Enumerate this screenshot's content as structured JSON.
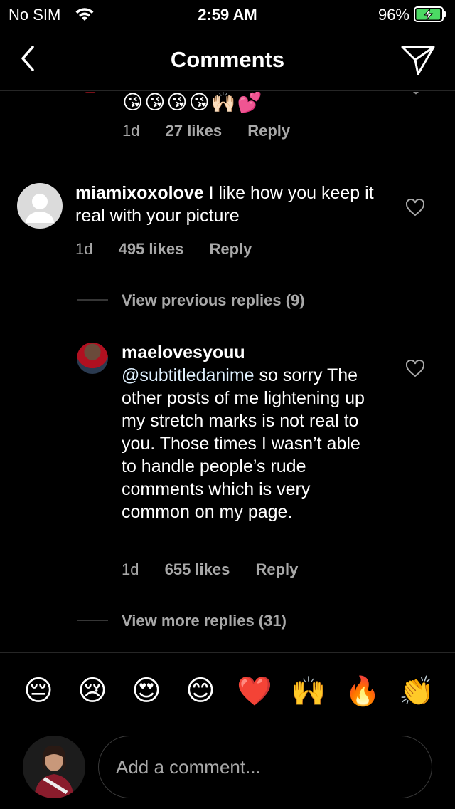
{
  "status_bar": {
    "carrier": "No SIM",
    "time": "2:59 AM",
    "battery_percent": "96%",
    "battery_level": 0.96,
    "charging": true,
    "battery_color": "#4cd964"
  },
  "nav": {
    "title": "Comments",
    "back_icon": "chevron-left-icon",
    "send_icon": "paper-plane-icon"
  },
  "comments": [
    {
      "emojis": "😘😘😘😘🙌🏻💕",
      "age": "1d",
      "likes": "27 likes",
      "reply_label": "Reply"
    },
    {
      "username": "miamixoxolove",
      "text": "I like how you keep it real with your picture",
      "age": "1d",
      "likes": "495 likes",
      "reply_label": "Reply",
      "view_previous": "View previous replies (9)"
    },
    {
      "username": "maelovesyouu",
      "mention": "@subtitledanime",
      "text": "so sorry The other posts of me lightening up my stretch marks is not real to you. Those times I wasn’t able to handle people’s rude comments which is very common on my page.",
      "age": "1d",
      "likes": "655 likes",
      "reply_label": "Reply",
      "view_more": "View more replies (31)"
    }
  ],
  "quick_emojis": [
    "😔",
    "😢",
    "😍",
    "😊",
    "❤️",
    "🙌",
    "🔥",
    "👏"
  ],
  "composer": {
    "placeholder": "Add a comment..."
  }
}
